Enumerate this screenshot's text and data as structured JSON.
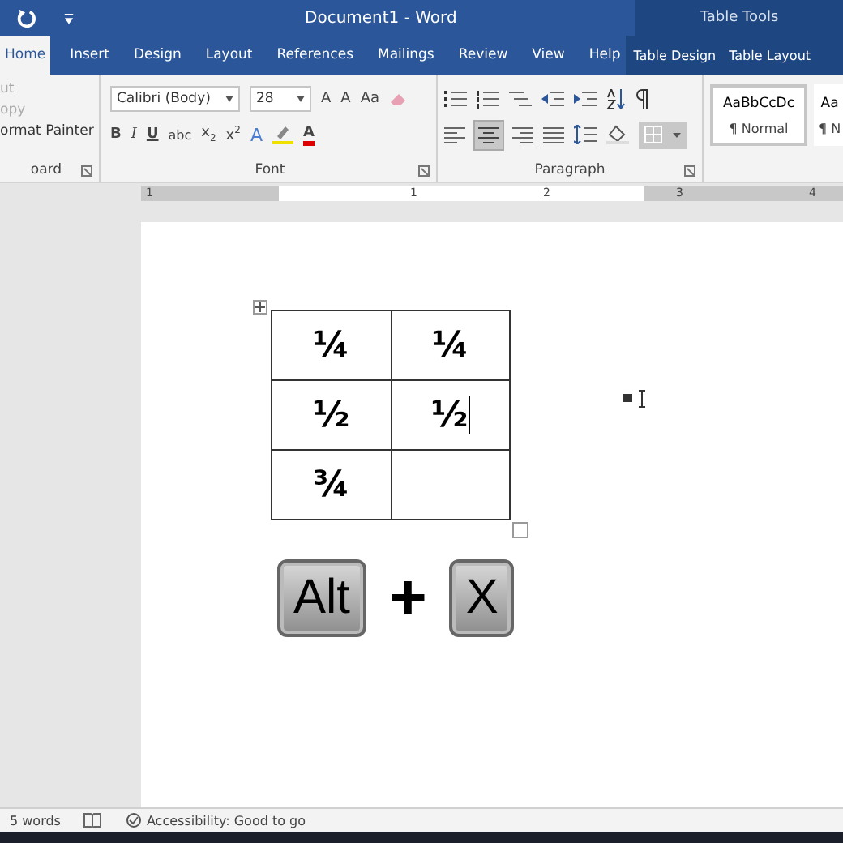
{
  "window": {
    "title": "Document1  -  Word",
    "context_title": "Table Tools"
  },
  "tabs": [
    {
      "label": "Home",
      "selected": true,
      "context": false
    },
    {
      "label": "Insert",
      "selected": false,
      "context": false
    },
    {
      "label": "Design",
      "selected": false,
      "context": false
    },
    {
      "label": "Layout",
      "selected": false,
      "context": false
    },
    {
      "label": "References",
      "selected": false,
      "context": false
    },
    {
      "label": "Mailings",
      "selected": false,
      "context": false
    },
    {
      "label": "Review",
      "selected": false,
      "context": false
    },
    {
      "label": "View",
      "selected": false,
      "context": false
    },
    {
      "label": "Help",
      "selected": false,
      "context": false
    },
    {
      "label": "Table Design",
      "selected": false,
      "context": true
    },
    {
      "label": "Table Layout",
      "selected": false,
      "context": true
    }
  ],
  "clipboard": {
    "items": [
      {
        "label": "ut",
        "disabled": true
      },
      {
        "label": "opy",
        "disabled": true
      },
      {
        "label": "ormat Painter",
        "disabled": false
      }
    ],
    "group_label": "oard"
  },
  "font": {
    "font_name": "Calibri (Body)",
    "font_size": "28",
    "grow": "A",
    "shrink": "A",
    "change_case": "Aa",
    "bold": "B",
    "italic": "I",
    "underline": "U",
    "strikethrough": "abc",
    "subscript": "x",
    "subscript_index": "2",
    "superscript": "x",
    "superscript_index": "2",
    "text_effects": "A",
    "font_color": "A",
    "group_label": "Font"
  },
  "paragraph": {
    "group_label": "Paragraph",
    "center_selected": true
  },
  "styles": [
    {
      "preview": "AaBbCcDc",
      "name": "¶ Normal",
      "selected": true
    },
    {
      "preview": "Aa",
      "name": "¶ N",
      "selected": false
    }
  ],
  "ruler": [
    "1",
    "1",
    "2",
    "3",
    "4"
  ],
  "table": {
    "rows": [
      [
        {
          "text": "¼",
          "caret": false
        },
        {
          "text": "¼",
          "caret": false
        }
      ],
      [
        {
          "text": "½",
          "caret": false
        },
        {
          "text": "½",
          "caret": true
        }
      ],
      [
        {
          "text": "¾",
          "caret": false
        },
        {
          "text": "",
          "caret": false
        }
      ]
    ]
  },
  "shortcut": {
    "keys": [
      "Alt",
      "X"
    ],
    "separator": "+"
  },
  "status_bar": {
    "word_count": "5 words",
    "accessibility": "Accessibility: Good to go"
  }
}
